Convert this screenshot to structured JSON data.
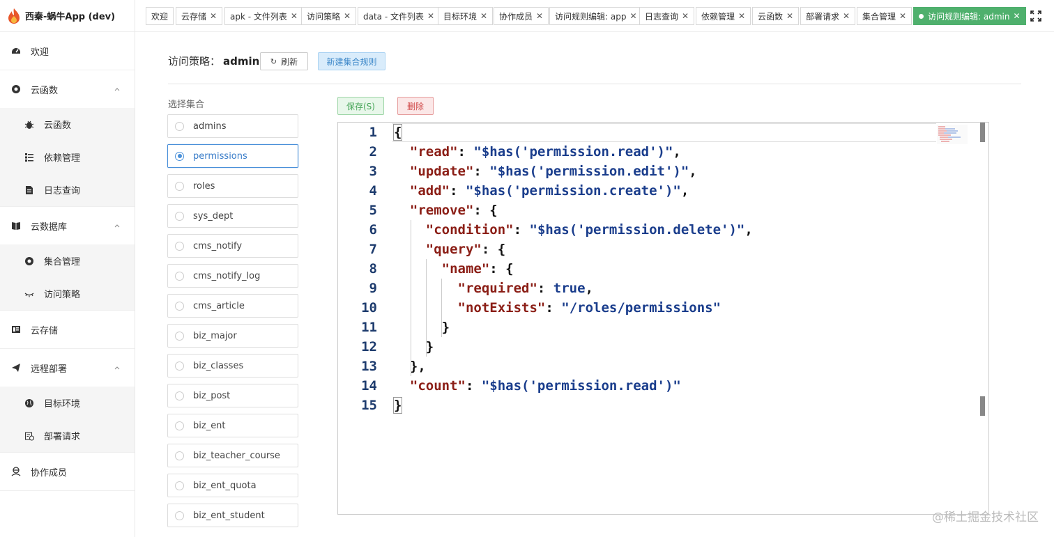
{
  "app": {
    "title": "西秦-蜗牛App (dev)"
  },
  "sidebar": {
    "items": [
      {
        "label": "欢迎",
        "icon": "dashboard-icon"
      },
      {
        "label": "云函数",
        "icon": "cloud-function-icon",
        "expanded": true,
        "children": [
          {
            "label": "云函数",
            "icon": "bug-icon"
          },
          {
            "label": "依赖管理",
            "icon": "list-icon"
          },
          {
            "label": "日志查询",
            "icon": "document-icon"
          }
        ]
      },
      {
        "label": "云数据库",
        "icon": "book-icon",
        "expanded": true,
        "children": [
          {
            "label": "集合管理",
            "icon": "gear-circle-icon"
          },
          {
            "label": "访问策略",
            "icon": "eye-closed-icon"
          }
        ]
      },
      {
        "label": "云存储",
        "icon": "storage-icon"
      },
      {
        "label": "远程部署",
        "icon": "paper-plane-icon",
        "expanded": true,
        "children": [
          {
            "label": "目标环境",
            "icon": "globe-icon"
          },
          {
            "label": "部署请求",
            "icon": "deploy-request-icon"
          }
        ]
      },
      {
        "label": "协作成员",
        "icon": "members-icon"
      }
    ]
  },
  "tabs": [
    {
      "label": "欢迎",
      "closable": false
    },
    {
      "label": "云存储",
      "closable": true
    },
    {
      "label": "apk - 文件列表",
      "closable": true
    },
    {
      "label": "访问策略",
      "closable": true
    },
    {
      "label": "data - 文件列表",
      "closable": true
    },
    {
      "label": "目标环境",
      "closable": true
    },
    {
      "label": "协作成员",
      "closable": true
    },
    {
      "label": "访问规则编辑: app",
      "closable": true
    },
    {
      "label": "日志查询",
      "closable": true
    },
    {
      "label": "依赖管理",
      "closable": true
    },
    {
      "label": "云函数",
      "closable": true
    },
    {
      "label": "部署请求",
      "closable": true
    },
    {
      "label": "集合管理",
      "closable": true
    },
    {
      "label": "访问规则编辑: admin",
      "closable": true,
      "active": true
    }
  ],
  "header": {
    "title_prefix": "访问策略：",
    "title_name": "admin",
    "refresh_label": "刷新",
    "new_rule_label": "新建集合规则"
  },
  "collections": {
    "label": "选择集合",
    "selected": "permissions",
    "items": [
      "admins",
      "permissions",
      "roles",
      "sys_dept",
      "cms_notify",
      "cms_notify_log",
      "cms_article",
      "biz_major",
      "biz_classes",
      "biz_post",
      "biz_ent",
      "biz_teacher_course",
      "biz_ent_quota",
      "biz_ent_student"
    ]
  },
  "actions": {
    "save_label": "保存(S)",
    "delete_label": "删除"
  },
  "editor": {
    "line_numbers": [
      "1",
      "2",
      "3",
      "4",
      "5",
      "6",
      "7",
      "8",
      "9",
      "10",
      "11",
      "12",
      "13",
      "14",
      "15"
    ],
    "lines": [
      [
        [
          "p",
          "{"
        ]
      ],
      [
        [
          "p",
          "  "
        ],
        [
          "k",
          "\"read\""
        ],
        [
          "p",
          ": "
        ],
        [
          "s",
          "\"$has('permission.read')\""
        ],
        [
          "p",
          ","
        ]
      ],
      [
        [
          "p",
          "  "
        ],
        [
          "k",
          "\"update\""
        ],
        [
          "p",
          ": "
        ],
        [
          "s",
          "\"$has('permission.edit')\""
        ],
        [
          "p",
          ","
        ]
      ],
      [
        [
          "p",
          "  "
        ],
        [
          "k",
          "\"add\""
        ],
        [
          "p",
          ": "
        ],
        [
          "s",
          "\"$has('permission.create')\""
        ],
        [
          "p",
          ","
        ]
      ],
      [
        [
          "p",
          "  "
        ],
        [
          "k",
          "\"remove\""
        ],
        [
          "p",
          ": {"
        ]
      ],
      [
        [
          "p",
          "    "
        ],
        [
          "k",
          "\"condition\""
        ],
        [
          "p",
          ": "
        ],
        [
          "s",
          "\"$has('permission.delete')\""
        ],
        [
          "p",
          ","
        ]
      ],
      [
        [
          "p",
          "    "
        ],
        [
          "k",
          "\"query\""
        ],
        [
          "p",
          ": {"
        ]
      ],
      [
        [
          "p",
          "      "
        ],
        [
          "k",
          "\"name\""
        ],
        [
          "p",
          ": {"
        ]
      ],
      [
        [
          "p",
          "        "
        ],
        [
          "k",
          "\"required\""
        ],
        [
          "p",
          ": "
        ],
        [
          "b",
          "true"
        ],
        [
          "p",
          ","
        ]
      ],
      [
        [
          "p",
          "        "
        ],
        [
          "k",
          "\"notExists\""
        ],
        [
          "p",
          ": "
        ],
        [
          "s",
          "\"/roles/permissions\""
        ]
      ],
      [
        [
          "p",
          "      }"
        ]
      ],
      [
        [
          "p",
          "    }"
        ]
      ],
      [
        [
          "p",
          "  },"
        ]
      ],
      [
        [
          "p",
          "  "
        ],
        [
          "k",
          "\"count\""
        ],
        [
          "p",
          ": "
        ],
        [
          "s",
          "\"$has('permission.read')\""
        ]
      ],
      [
        [
          "p",
          "}"
        ]
      ]
    ]
  },
  "watermark": "@稀土掘金技术社区",
  "colors": {
    "active_tab": "#4fb06d",
    "selected": "#4a90d9",
    "key": "#8b1e16",
    "string": "#1a3d8c"
  }
}
